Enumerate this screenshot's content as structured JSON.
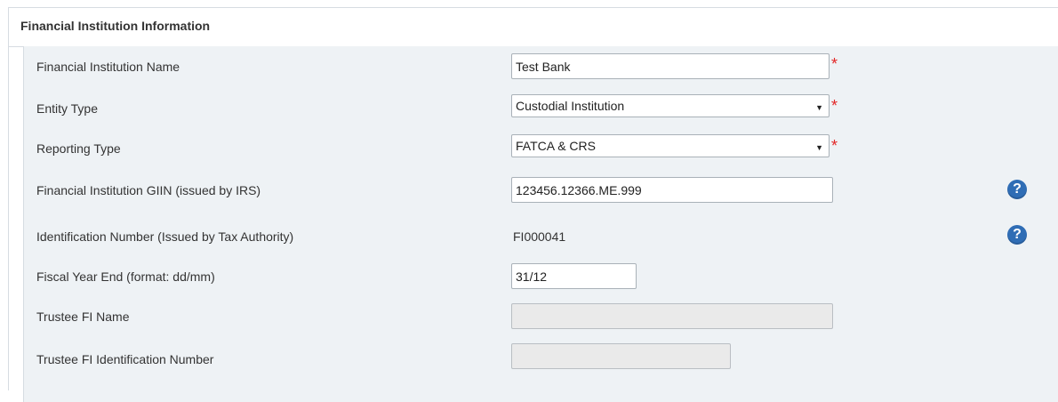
{
  "section": {
    "title": "Financial Institution Information"
  },
  "fields": {
    "fi_name": {
      "label": "Financial Institution Name",
      "value": "Test Bank",
      "required_mark": "*"
    },
    "entity_type": {
      "label": "Entity Type",
      "value": "Custodial Institution",
      "required_mark": "*"
    },
    "reporting_type": {
      "label": "Reporting Type",
      "value": "FATCA & CRS",
      "required_mark": "*"
    },
    "giin": {
      "label": "Financial Institution GIIN (issued by IRS)",
      "value": "123456.12366.ME.999",
      "help": "?"
    },
    "identification_number": {
      "label": "Identification Number (Issued by Tax Authority)",
      "value": "FI000041",
      "help": "?"
    },
    "fiscal_year_end": {
      "label": "Fiscal Year End (format: dd/mm)",
      "value": "31/12"
    },
    "trustee_fi_name": {
      "label": "Trustee FI Name",
      "value": ""
    },
    "trustee_fi_id": {
      "label": "Trustee FI Identification Number",
      "value": ""
    }
  },
  "icons": {
    "dropdown_arrow": "▼",
    "help_color": "#2f6db5",
    "required_color": "#e32626"
  }
}
